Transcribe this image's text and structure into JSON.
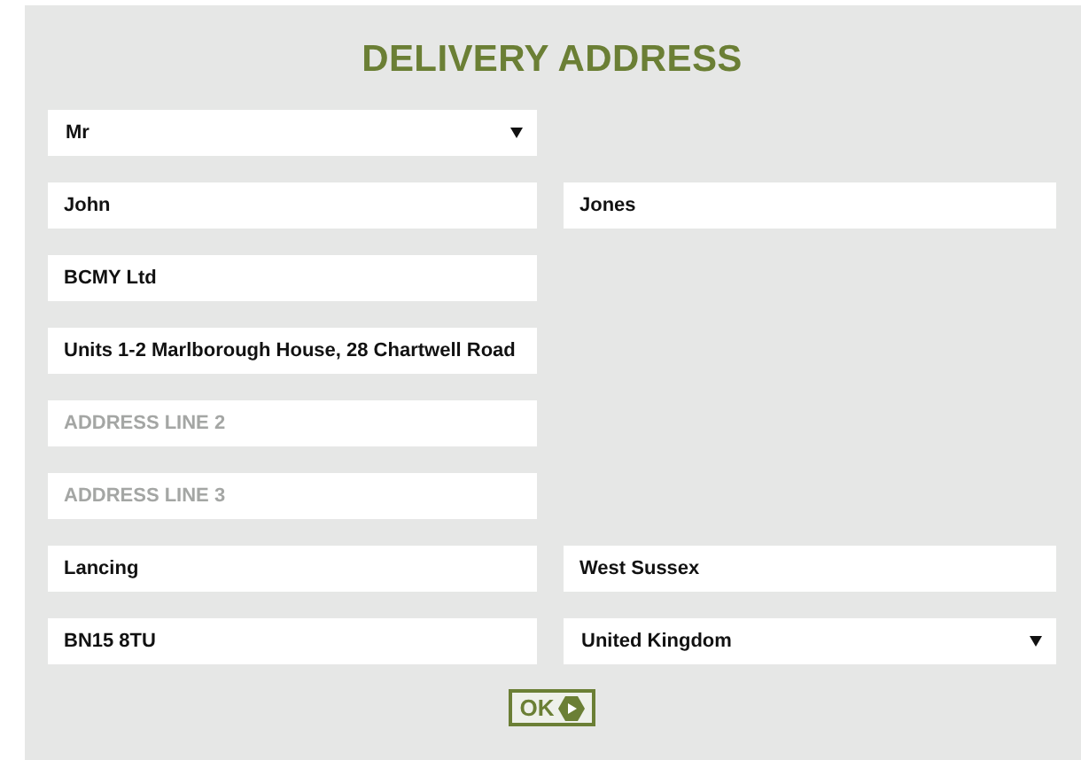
{
  "title": "DELIVERY ADDRESS",
  "rows": [
    [
      {
        "kind": "select",
        "value": "Mr"
      }
    ],
    [
      {
        "kind": "text",
        "value": "John"
      },
      {
        "kind": "text",
        "value": "Jones"
      }
    ],
    [
      {
        "kind": "text",
        "value": "BCMY Ltd"
      }
    ],
    [
      {
        "kind": "text",
        "value": "Units 1-2 Marlborough House, 28 Chartwell Road"
      }
    ],
    [
      {
        "kind": "text",
        "placeholder": "ADDRESS LINE 2"
      }
    ],
    [
      {
        "kind": "text",
        "placeholder": "ADDRESS LINE 3"
      }
    ],
    [
      {
        "kind": "text",
        "value": "Lancing"
      },
      {
        "kind": "text",
        "value": "West Sussex"
      }
    ],
    [
      {
        "kind": "text",
        "value": "BN15 8TU"
      },
      {
        "kind": "select",
        "value": "United Kingdom"
      }
    ]
  ],
  "ok_button": {
    "label": "OK"
  }
}
